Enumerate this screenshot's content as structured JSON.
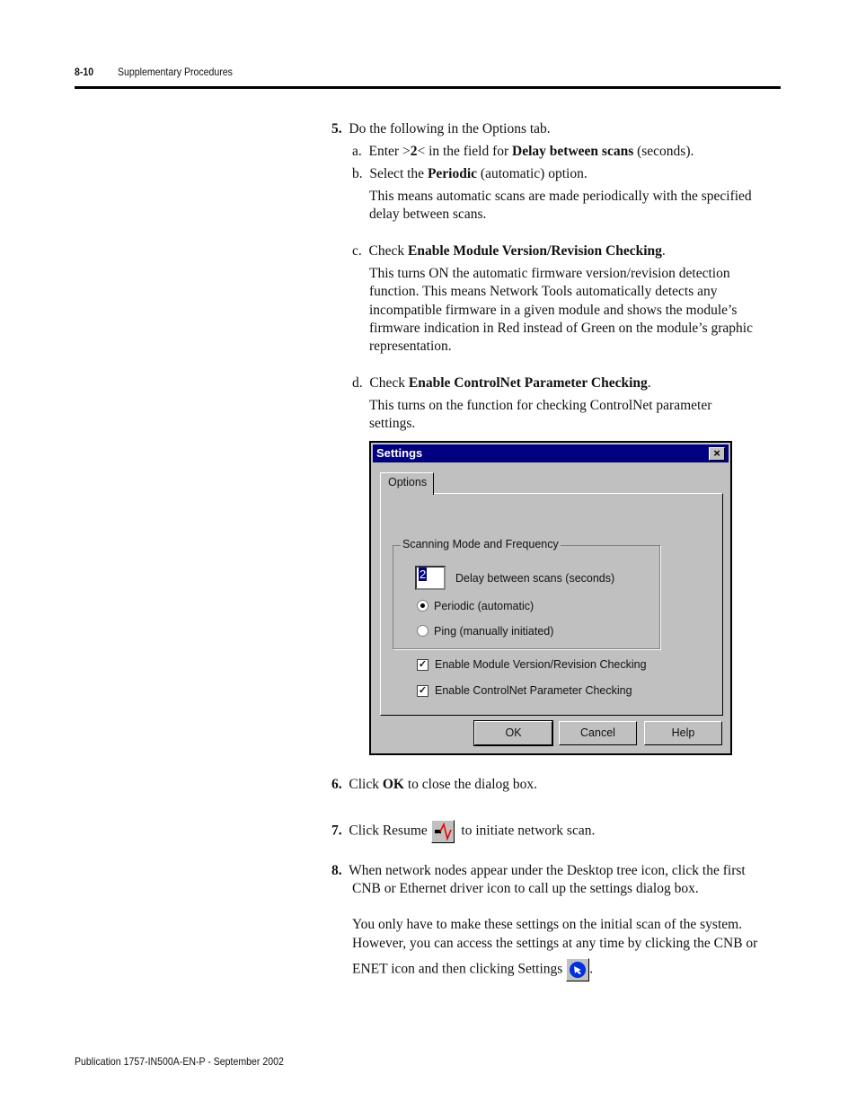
{
  "header": {
    "page_number": "8-10",
    "section": "Supplementary Procedures"
  },
  "steps": {
    "s5": {
      "num": "5.",
      "text": "Do the following in the Options tab.",
      "a": {
        "label": "a.",
        "pre": "Enter >",
        "bold1": "2",
        "mid": "< in the field for ",
        "bold2": "Delay between scans",
        "post": " (seconds)."
      },
      "b": {
        "label": "b.",
        "pre": "Select the ",
        "bold": "Periodic",
        "post": " (automatic) option.",
        "note1": "This means automatic scans are made periodically with the specified",
        "note2": "delay between scans."
      },
      "c": {
        "label": "c.",
        "pre": "Check ",
        "bold": "Enable Module Version/Revision Checking",
        "post": ".",
        "lines": [
          "This turns ON the automatic firmware version/revision detection",
          "function. This means Network Tools automatically detects any",
          "incompatible firmware in a given module and shows the module’s",
          "firmware indication in Red instead of Green on the module’s graphic",
          "representation."
        ]
      },
      "d": {
        "label": "d.",
        "pre": "Check ",
        "bold": "Enable ControlNet Parameter Checking",
        "post": ".",
        "lines": [
          "This turns on the function for checking ControlNet parameter",
          "settings."
        ]
      }
    },
    "s6": {
      "num": "6.",
      "pre": "Click ",
      "bold": "OK",
      "post": " to close the dialog box."
    },
    "s7": {
      "num": "7.",
      "pre": "Click Resume",
      "post": "to initiate network scan.",
      "icon": "resume-scan-icon"
    },
    "s8": {
      "num": "8.",
      "lines": [
        "When network nodes appear under the Desktop tree icon, click the first",
        "CNB or Ethernet driver icon to call up the settings dialog box."
      ],
      "para": [
        "You only have to make these settings on the initial scan of the system.",
        "However, you can access the settings at any time by clicking the CNB or"
      ],
      "last_pre": "ENET icon and then clicking Settings",
      "last_post": ".",
      "icon": "settings-icon"
    }
  },
  "dialog": {
    "title": "Settings",
    "tab": "Options",
    "group": "Scanning Mode and Frequency",
    "delay_value": "2",
    "delay_label": "Delay between scans (seconds)",
    "radio_periodic": "Periodic (automatic)",
    "radio_ping": "Ping (manually initiated)",
    "selected_mode": "Periodic (automatic)",
    "check_version": "Enable Module Version/Revision Checking",
    "check_version_checked": true,
    "check_param": "Enable ControlNet Parameter Checking",
    "check_param_checked": true,
    "ok": "OK",
    "cancel": "Cancel",
    "help": "Help",
    "title_color": "#000080"
  },
  "footer": "Publication 1757-IN500A-EN-P - September 2002"
}
